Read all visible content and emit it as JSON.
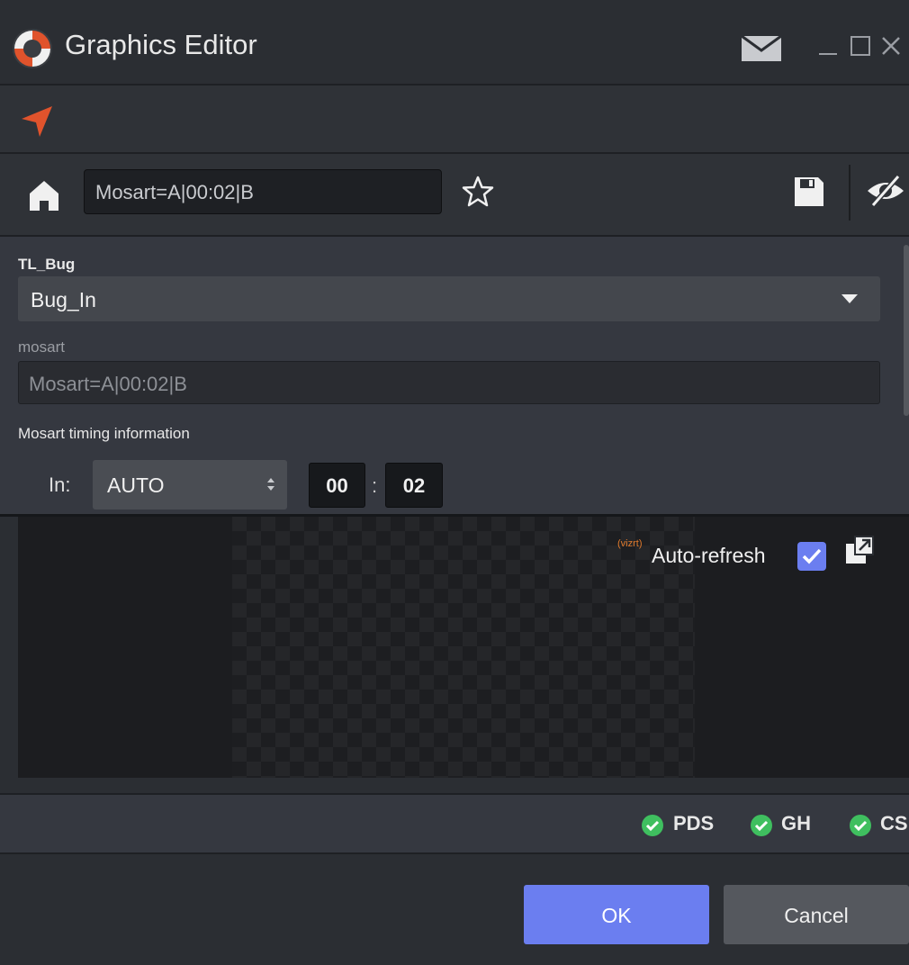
{
  "window": {
    "title": "Graphics Editor",
    "icons": [
      "app-logo-icon",
      "mail-icon",
      "minimize-icon",
      "maximize-icon",
      "close-icon"
    ]
  },
  "toolbar": {
    "nav_icon": "navigate-arrow-icon",
    "home_icon": "home-icon",
    "search_value": "Mosart=A|00:02|B",
    "favorite_icon": "star-icon",
    "save_icon": "save-icon",
    "visibility_icon": "eye-off-icon"
  },
  "form": {
    "template_label": "TL_Bug",
    "template_value": "Bug_In",
    "mosart_label": "mosart",
    "mosart_value": "Mosart=A|00:02|B",
    "timing_label": "Mosart timing information",
    "in_label": "In:",
    "in_mode": "AUTO",
    "in_minutes": "00",
    "time_separator": ":",
    "in_seconds": "02"
  },
  "preview": {
    "logo_text": "(vizrt)",
    "auto_refresh_label": "Auto-refresh",
    "auto_refresh_checked": true,
    "popout_icon": "popout-icon"
  },
  "status": [
    {
      "label": "PDS",
      "state": "ok"
    },
    {
      "label": "GH",
      "state": "ok"
    },
    {
      "label": "CS",
      "state": "ok"
    }
  ],
  "buttons": {
    "ok_label": "OK",
    "cancel_label": "Cancel"
  },
  "colors": {
    "accent": "#6b7ef0",
    "brand_orange": "#e0532c",
    "status_ok": "#3fbf5f",
    "background": "#2b2e33"
  }
}
